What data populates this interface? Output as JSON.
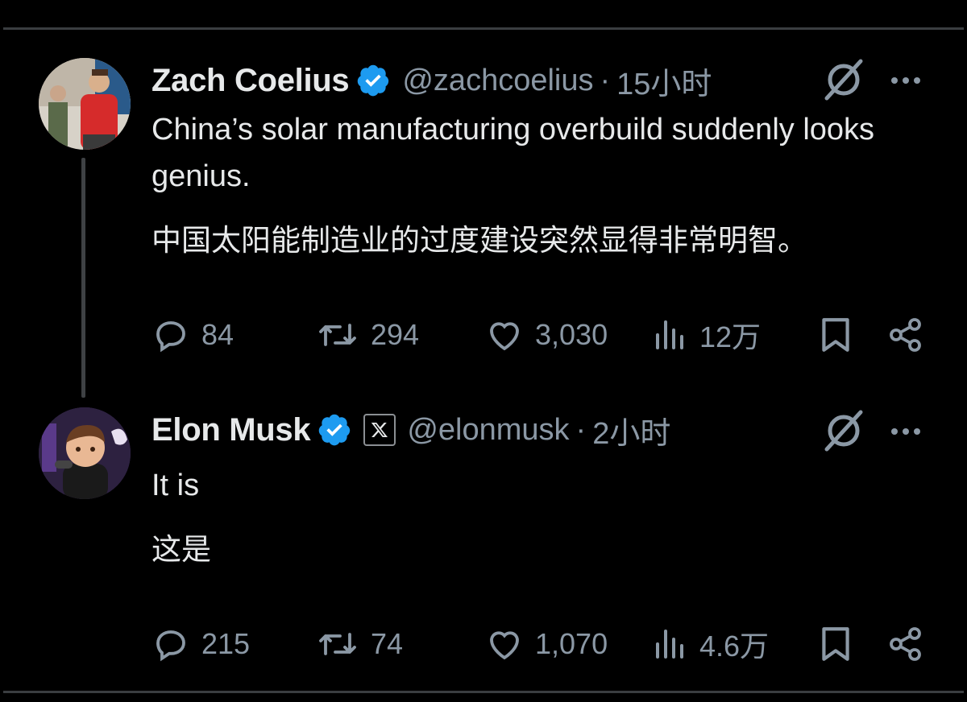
{
  "tweets": [
    {
      "name": "Zach Coelius",
      "handle": "@zachcoelius",
      "separator": "·",
      "time": "15小时",
      "text_en": "China’s solar manufacturing overbuild suddenly looks genius.",
      "text_cn": "中国太阳能制造业的过度建设突然显得非常明智。",
      "replies": "84",
      "reposts": "294",
      "likes": "3,030",
      "views": "12万",
      "avatar_icon": "avatar-photo-presenter",
      "verified": true
    },
    {
      "name": "Elon Musk",
      "handle": "@elonmusk",
      "separator": "·",
      "time": "2小时",
      "text_en": "It is",
      "text_cn": "这是",
      "replies": "215",
      "reposts": "74",
      "likes": "1,070",
      "views": "4.6万",
      "avatar_icon": "avatar-cartoon",
      "verified": true,
      "affiliate_badge": "x-logo-badge"
    }
  ],
  "colors": {
    "background": "#000000",
    "text": "#e7e9ea",
    "muted": "#8b98a5",
    "verified": "#1d9bf0",
    "divider": "#3a3d40"
  }
}
